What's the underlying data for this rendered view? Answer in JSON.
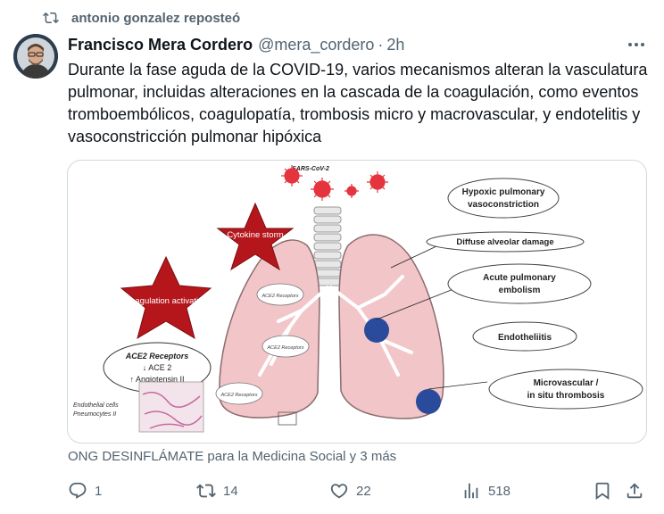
{
  "repost": {
    "text": "antonio gonzalez reposteó",
    "icon": "repost-icon"
  },
  "tweet": {
    "author_name": "Francisco Mera Cordero",
    "handle": "@mera_cordero",
    "separator": "·",
    "time": "2h",
    "text": "Durante la fase aguda de la COVID-19, varios mecanismos alteran la vasculatura pulmonar, incluidas alteraciones en la cascada de la coagulación, como eventos tromboembólicos, coagulopatía, trombosis micro y macrovascular, y endotelitis y vasoconstricción pulmonar hipóxica",
    "tags": "ONG DESINFLÁMATE para la Medicina Social y 3 más"
  },
  "figure": {
    "virus_label": "SARS-CoV-2",
    "stars": [
      "Cytokine storm",
      "Coagulation activation"
    ],
    "receptor_box": {
      "title": "ACE2 Receptors",
      "line1": "↓ ACE 2",
      "line2": "↑ Angiotensin II"
    },
    "ace2_labels": [
      "ACE2 Receptors",
      "ACE2 Receptors",
      "ACE2 Receptors"
    ],
    "cells_label": [
      "Endothelial cells",
      "Pneumocytes II"
    ],
    "callouts": [
      "Hypoxic pulmonary vasoconstriction",
      "Diffuse alveolar damage",
      "Acute pulmonary embolism",
      "Endotheliitis",
      "Microvascular / in situ thrombosis"
    ],
    "colors": {
      "lung": "#f2c5c8",
      "star": "#b5161c",
      "virus": "#e4353f",
      "clot": "#2a4b9b"
    }
  },
  "actions": {
    "reply": {
      "count": "1",
      "icon": "reply-icon"
    },
    "repost": {
      "count": "14",
      "icon": "repost-icon"
    },
    "like": {
      "count": "22",
      "icon": "heart-icon"
    },
    "views": {
      "count": "518",
      "icon": "views-icon"
    },
    "bookmark": {
      "icon": "bookmark-icon"
    },
    "share": {
      "icon": "share-icon"
    }
  }
}
